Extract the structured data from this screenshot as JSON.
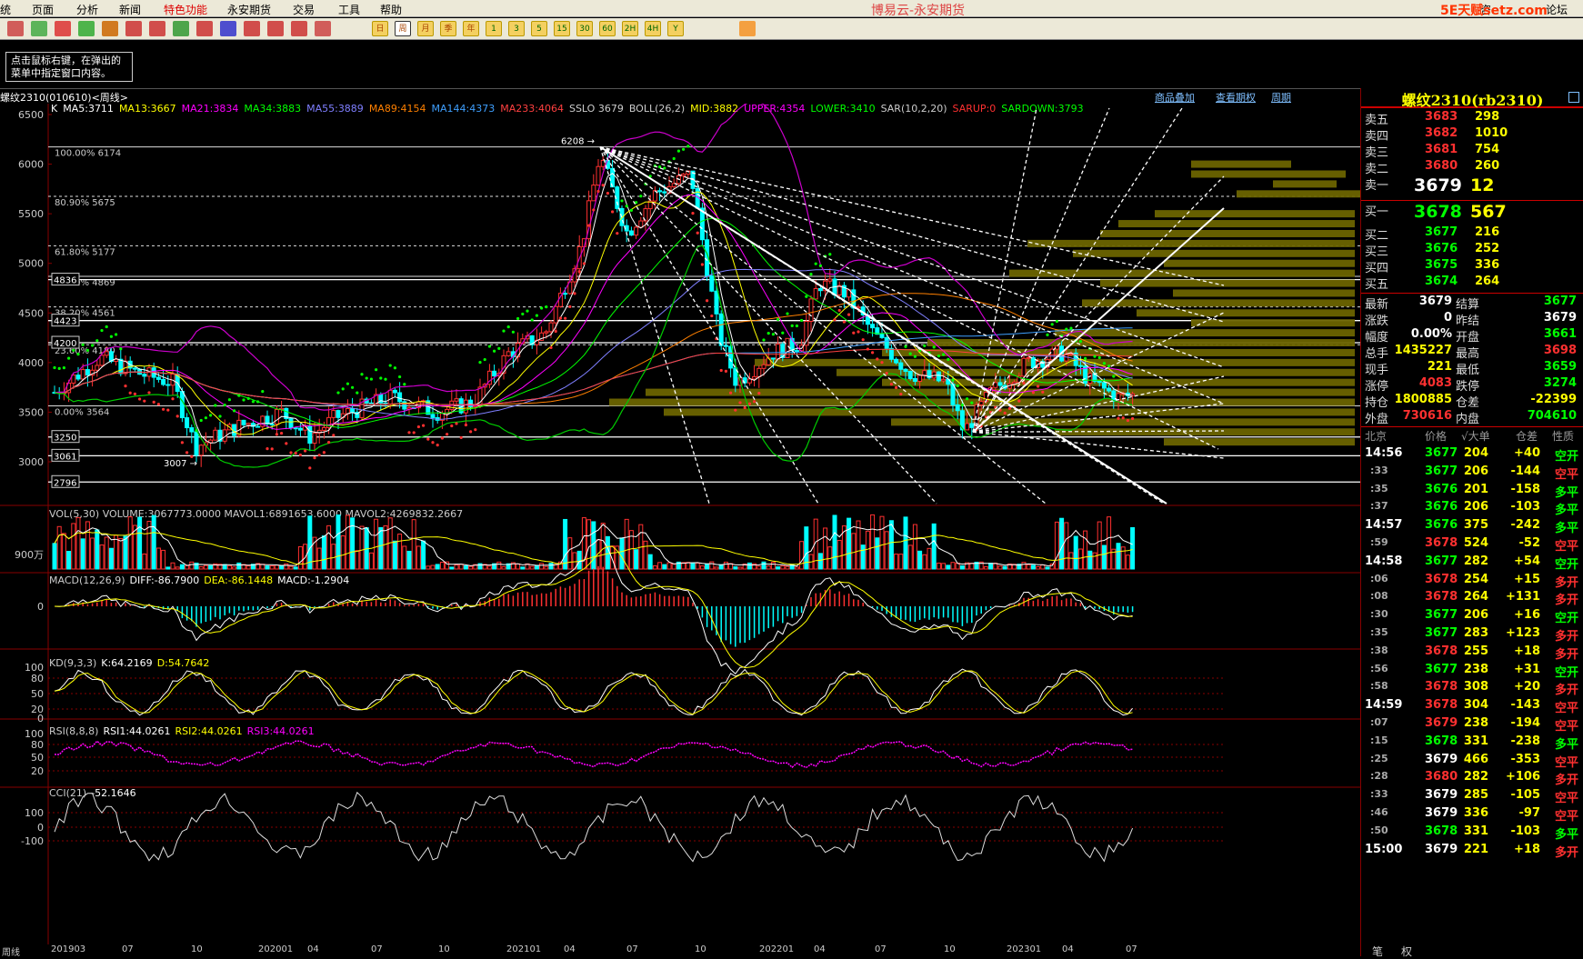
{
  "menu": {
    "items": [
      "统",
      "页面",
      "分析",
      "新闻",
      "特色功能",
      "永安期货",
      "交易",
      "工具",
      "帮助"
    ],
    "app_title": "博易云-永安期货",
    "brand": "5E天赋setz.com",
    "right_items": [
      "咨",
      "论坛"
    ]
  },
  "toolbar": {
    "period_buttons": [
      "日",
      "周",
      "月",
      "季",
      "年",
      "1",
      "3",
      "5",
      "15",
      "30",
      "60",
      "2H",
      "4H",
      "Y"
    ]
  },
  "hint": {
    "line1": "点击鼠标右键，在弹出的",
    "line2": "菜单中指定窗口内容。"
  },
  "chart": {
    "title": "螺纹2310(010610)<周线>",
    "links": [
      "商品叠加",
      "查看期权",
      "周期"
    ],
    "indicator_line": [
      {
        "text": "K",
        "color": "#ffffff"
      },
      {
        "text": "MA5:3711",
        "color": "#ffffff"
      },
      {
        "text": "MA13:3667",
        "color": "#ffff00"
      },
      {
        "text": "MA21:3834",
        "color": "#ff00ff"
      },
      {
        "text": "MA34:3883",
        "color": "#00ff00"
      },
      {
        "text": "MA55:3889",
        "color": "#7f7fff"
      },
      {
        "text": "MA89:4154",
        "color": "#ff8000"
      },
      {
        "text": "MA144:4373",
        "color": "#3fa0ff"
      },
      {
        "text": "MA233:4064",
        "color": "#ff4040"
      },
      {
        "text": "SSLO 3679",
        "color": "#cccccc"
      },
      {
        "text": "BOLL(26,2)",
        "color": "#cccccc"
      },
      {
        "text": "MID:3882",
        "color": "#ffff00"
      },
      {
        "text": "UPPER:4354",
        "color": "#ff00ff"
      },
      {
        "text": "LOWER:3410",
        "color": "#00ff00"
      },
      {
        "text": "SAR(10,2,20)",
        "color": "#cccccc"
      },
      {
        "text": "SARUP:0",
        "color": "#ff3030"
      },
      {
        "text": "SARDOWN:3793",
        "color": "#00ff00"
      }
    ],
    "y_ticks": [
      "6500",
      "6000",
      "5500",
      "5000",
      "4500",
      "4000",
      "3500",
      "3000"
    ],
    "fib": [
      {
        "label": "100.00% 6174"
      },
      {
        "label": "80.90% 5675"
      },
      {
        "label": "61.80% 5177"
      },
      {
        "label": "50.00% 4869"
      },
      {
        "label": "38.20% 4561"
      },
      {
        "label": "23.60% 4180"
      },
      {
        "label": "0.00% 3564"
      }
    ],
    "price_boxes": [
      "4836",
      "4423",
      "4200",
      "3250",
      "3061",
      "2796"
    ],
    "peak_label": "6208",
    "low_label": "3007",
    "vol_line": "VOL(5,30)  VOLUME:3067773.0000  MAVOL1:6891653.6000  MAVOL2:4269832.2667",
    "vol_tick": "900万",
    "macd_line": [
      {
        "text": "MACD(12,26,9)",
        "color": "#cccccc"
      },
      {
        "text": "DIFF:-86.7900",
        "color": "#ffffff"
      },
      {
        "text": "DEA:-86.1448",
        "color": "#ffff00"
      },
      {
        "text": "MACD:-1.2904",
        "color": "#ffffff"
      }
    ],
    "macd_tick": "0",
    "kd_line": [
      {
        "text": "KD(9,3,3)",
        "color": "#cccccc"
      },
      {
        "text": "K:64.2169",
        "color": "#ffffff"
      },
      {
        "text": "D:54.7642",
        "color": "#ffff00"
      }
    ],
    "kd_ticks": [
      "100",
      "80",
      "50",
      "20",
      "0"
    ],
    "rsi_line": [
      {
        "text": "RSI(8,8,8)",
        "color": "#cccccc"
      },
      {
        "text": "RSI1:44.0261",
        "color": "#ffffff"
      },
      {
        "text": "RSI2:44.0261",
        "color": "#ffff00"
      },
      {
        "text": "RSI3:44.0261",
        "color": "#ff00ff"
      }
    ],
    "rsi_ticks": [
      "100",
      "80",
      "50",
      "20"
    ],
    "cci_line": [
      {
        "text": "CCI(21)",
        "color": "#cccccc"
      },
      {
        "text": "-52.1646",
        "color": "#ffffff"
      }
    ],
    "cci_ticks": [
      "100",
      "0",
      "-100"
    ],
    "x_labels": [
      "周线",
      "201903",
      "07",
      "10",
      "202001",
      "04",
      "07",
      "10",
      "202101",
      "04",
      "07",
      "10",
      "202201",
      "04",
      "07",
      "10",
      "202301",
      "04",
      "07"
    ]
  },
  "quote": {
    "title": "螺纹2310(rb2310)",
    "asks": [
      {
        "label": "卖五",
        "price": "3683",
        "vol": "298"
      },
      {
        "label": "卖四",
        "price": "3682",
        "vol": "1010"
      },
      {
        "label": "卖三",
        "price": "3681",
        "vol": "754"
      },
      {
        "label": "卖二",
        "price": "3680",
        "vol": "260"
      },
      {
        "label": "卖一",
        "price": "3679",
        "vol": "12"
      }
    ],
    "bids": [
      {
        "label": "买一",
        "price": "3678",
        "vol": "567"
      },
      {
        "label": "买二",
        "price": "3677",
        "vol": "216"
      },
      {
        "label": "买三",
        "price": "3676",
        "vol": "252"
      },
      {
        "label": "买四",
        "price": "3675",
        "vol": "336"
      },
      {
        "label": "买五",
        "price": "3674",
        "vol": "264"
      }
    ],
    "stats": [
      {
        "l1": "最新",
        "v1": "3679",
        "c1": "#ffffff",
        "l2": "结算",
        "v2": "3677",
        "c2": "#00ff00"
      },
      {
        "l1": "涨跌",
        "v1": "0",
        "c1": "#ffffff",
        "l2": "昨结",
        "v2": "3679",
        "c2": "#ffffff"
      },
      {
        "l1": "幅度",
        "v1": "0.00%",
        "c1": "#ffffff",
        "l2": "开盘",
        "v2": "3661",
        "c2": "#00ff00"
      },
      {
        "l1": "总手",
        "v1": "1435227",
        "c1": "#ffff00",
        "l2": "最高",
        "v2": "3698",
        "c2": "#ff3030"
      },
      {
        "l1": "现手",
        "v1": "221",
        "c1": "#ffff00",
        "l2": "最低",
        "v2": "3659",
        "c2": "#00ff00"
      },
      {
        "l1": "涨停",
        "v1": "4083",
        "c1": "#ff3030",
        "l2": "跌停",
        "v2": "3274",
        "c2": "#00ff00"
      },
      {
        "l1": "持仓",
        "v1": "1800885",
        "c1": "#ffff00",
        "l2": "仓差",
        "v2": "-22399",
        "c2": "#ffff00"
      },
      {
        "l1": "外盘",
        "v1": "730616",
        "c1": "#ff3030",
        "l2": "内盘",
        "v2": "704610",
        "c2": "#00ff00"
      }
    ],
    "tick_header": [
      "北京",
      "价格",
      "√大单",
      "仓差",
      "性质"
    ],
    "ticks": [
      {
        "t": "14:56",
        "p": "3677",
        "pc": "#00ff00",
        "v": "204",
        "d": "+40",
        "n": "空开",
        "nc": "#00ff00"
      },
      {
        "t": ":33",
        "p": "3677",
        "pc": "#00ff00",
        "v": "206",
        "d": "-144",
        "n": "空平",
        "nc": "#ff3030"
      },
      {
        "t": ":35",
        "p": "3676",
        "pc": "#00ff00",
        "v": "201",
        "d": "-158",
        "n": "多平",
        "nc": "#00ff00"
      },
      {
        "t": ":37",
        "p": "3676",
        "pc": "#00ff00",
        "v": "206",
        "d": "-103",
        "n": "多平",
        "nc": "#00ff00"
      },
      {
        "t": "14:57",
        "p": "3676",
        "pc": "#00ff00",
        "v": "375",
        "d": "-242",
        "n": "多平",
        "nc": "#00ff00"
      },
      {
        "t": ":59",
        "p": "3678",
        "pc": "#ff3030",
        "v": "524",
        "d": "-52",
        "n": "空平",
        "nc": "#ff3030"
      },
      {
        "t": "14:58",
        "p": "3677",
        "pc": "#00ff00",
        "v": "282",
        "d": "+54",
        "n": "空开",
        "nc": "#00ff00"
      },
      {
        "t": ":06",
        "p": "3678",
        "pc": "#ff3030",
        "v": "254",
        "d": "+15",
        "n": "多开",
        "nc": "#ff3030"
      },
      {
        "t": ":08",
        "p": "3678",
        "pc": "#ff3030",
        "v": "264",
        "d": "+131",
        "n": "多开",
        "nc": "#ff3030"
      },
      {
        "t": ":30",
        "p": "3677",
        "pc": "#00ff00",
        "v": "206",
        "d": "+16",
        "n": "空开",
        "nc": "#00ff00"
      },
      {
        "t": ":35",
        "p": "3677",
        "pc": "#00ff00",
        "v": "283",
        "d": "+123",
        "n": "多开",
        "nc": "#ff3030"
      },
      {
        "t": ":38",
        "p": "3678",
        "pc": "#ff3030",
        "v": "255",
        "d": "+18",
        "n": "多开",
        "nc": "#ff3030"
      },
      {
        "t": ":56",
        "p": "3677",
        "pc": "#00ff00",
        "v": "238",
        "d": "+31",
        "n": "空开",
        "nc": "#00ff00"
      },
      {
        "t": ":58",
        "p": "3678",
        "pc": "#ff3030",
        "v": "308",
        "d": "+20",
        "n": "多开",
        "nc": "#ff3030"
      },
      {
        "t": "14:59",
        "p": "3678",
        "pc": "#ff3030",
        "v": "304",
        "d": "-143",
        "n": "空平",
        "nc": "#ff3030"
      },
      {
        "t": ":07",
        "p": "3679",
        "pc": "#ff3030",
        "v": "238",
        "d": "-194",
        "n": "空平",
        "nc": "#ff3030"
      },
      {
        "t": ":15",
        "p": "3678",
        "pc": "#00ff00",
        "v": "331",
        "d": "-238",
        "n": "多平",
        "nc": "#00ff00"
      },
      {
        "t": ":25",
        "p": "3679",
        "pc": "#ffffff",
        "v": "466",
        "d": "-353",
        "n": "空平",
        "nc": "#ff3030"
      },
      {
        "t": ":28",
        "p": "3680",
        "pc": "#ff3030",
        "v": "282",
        "d": "+106",
        "n": "多开",
        "nc": "#ff3030"
      },
      {
        "t": ":33",
        "p": "3679",
        "pc": "#ffffff",
        "v": "285",
        "d": "-105",
        "n": "空平",
        "nc": "#ff3030"
      },
      {
        "t": ":46",
        "p": "3679",
        "pc": "#ffffff",
        "v": "336",
        "d": "-97",
        "n": "空平",
        "nc": "#ff3030"
      },
      {
        "t": ":50",
        "p": "3678",
        "pc": "#00ff00",
        "v": "331",
        "d": "-103",
        "n": "多平",
        "nc": "#00ff00"
      },
      {
        "t": "15:00",
        "p": "3679",
        "pc": "#ffffff",
        "v": "221",
        "d": "+18",
        "n": "多开",
        "nc": "#ff3030"
      }
    ],
    "bottom_tabs": [
      "笔",
      "权"
    ]
  }
}
